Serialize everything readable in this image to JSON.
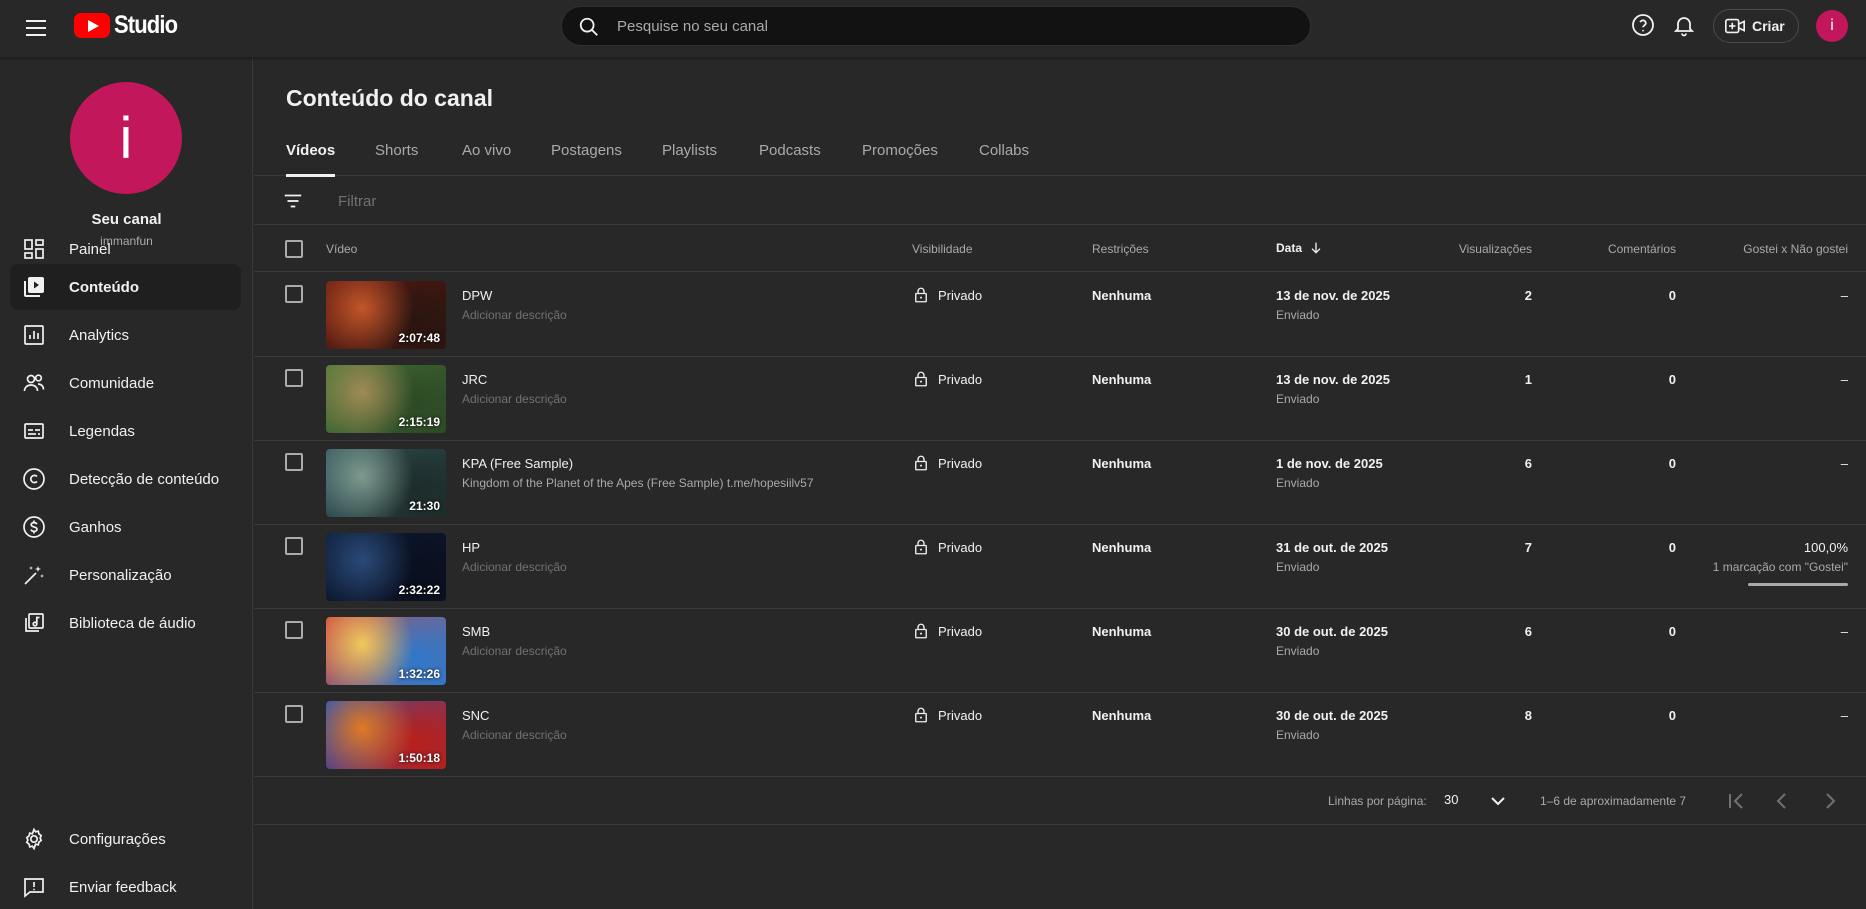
{
  "header": {
    "logo_text": "Studio",
    "search_placeholder": "Pesquise no seu canal",
    "create_label": "Criar",
    "avatar_letter": "i"
  },
  "sidebar": {
    "avatar_letter": "i",
    "channel_title": "Seu canal",
    "channel_handle": "immanfun",
    "items": [
      {
        "label": "Painel",
        "icon": "dashboard-icon"
      },
      {
        "label": "Conteúdo",
        "icon": "content-icon",
        "active": true
      },
      {
        "label": "Analytics",
        "icon": "analytics-icon"
      },
      {
        "label": "Comunidade",
        "icon": "community-icon"
      },
      {
        "label": "Legendas",
        "icon": "subtitles-icon"
      },
      {
        "label": "Detecção de conteúdo",
        "icon": "copyright-icon"
      },
      {
        "label": "Ganhos",
        "icon": "earn-icon"
      },
      {
        "label": "Personalização",
        "icon": "customization-icon"
      },
      {
        "label": "Biblioteca de áudio",
        "icon": "audio-library-icon"
      }
    ],
    "footer": [
      {
        "label": "Configurações",
        "icon": "settings-icon"
      },
      {
        "label": "Enviar feedback",
        "icon": "feedback-icon"
      }
    ]
  },
  "main": {
    "title": "Conteúdo do canal",
    "tabs": [
      "Vídeos",
      "Shorts",
      "Ao vivo",
      "Postagens",
      "Playlists",
      "Podcasts",
      "Promoções",
      "Collabs"
    ],
    "filter_placeholder": "Filtrar",
    "columns": {
      "video": "Vídeo",
      "visibility": "Visibilidade",
      "restrictions": "Restrições",
      "date": "Data",
      "views": "Visualizações",
      "comments": "Comentários",
      "likes": "Gostei x Não gostei"
    },
    "rows": [
      {
        "title": "DPW",
        "description": "Adicionar descrição",
        "duration": "2:07:48",
        "visibility": "Privado",
        "restrictions": "Nenhuma",
        "date": "13 de nov. de 2025",
        "date_status": "Enviado",
        "views": "2",
        "comments": "0",
        "likes": "–",
        "colors": [
          "#6b1d12",
          "#c2562a",
          "#2a1510"
        ]
      },
      {
        "title": "JRC",
        "description": "Adicionar descrição",
        "duration": "2:15:19",
        "visibility": "Privado",
        "restrictions": "Nenhuma",
        "date": "13 de nov. de 2025",
        "date_status": "Enviado",
        "views": "1",
        "comments": "0",
        "likes": "–",
        "colors": [
          "#4f7a3a",
          "#a08a55",
          "#2c4a26"
        ]
      },
      {
        "title": "KPA (Free Sample)",
        "description": "Kingdom of the Planet of the Apes (Free Sample) t.me/hopesiilv57",
        "duration": "21:30",
        "visibility": "Privado",
        "restrictions": "Nenhuma",
        "date": "1 de nov. de 2025",
        "date_status": "Enviado",
        "views": "6",
        "comments": "0",
        "likes": "–",
        "colors": [
          "#3a5e66",
          "#7e9a8e",
          "#1c2c2a"
        ]
      },
      {
        "title": "HP",
        "description": "Adicionar descrição",
        "duration": "2:32:22",
        "visibility": "Privado",
        "restrictions": "Nenhuma",
        "date": "31 de out. de 2025",
        "date_status": "Enviado",
        "views": "7",
        "comments": "0",
        "likes": "100,0%",
        "likes_sub": "1 marcação com \"Gostei\"",
        "likes_ratio": 1.0,
        "colors": [
          "#0d1e3a",
          "#2b4a78",
          "#0a0f1e"
        ]
      },
      {
        "title": "SMB",
        "description": "Adicionar descrição",
        "duration": "1:32:26",
        "visibility": "Privado",
        "restrictions": "Nenhuma",
        "date": "30 de out. de 2025",
        "date_status": "Enviado",
        "views": "6",
        "comments": "0",
        "likes": "–",
        "colors": [
          "#d8493c",
          "#f2c85a",
          "#2f78c9"
        ]
      },
      {
        "title": "SNC",
        "description": "Adicionar descrição",
        "duration": "1:50:18",
        "visibility": "Privado",
        "restrictions": "Nenhuma",
        "date": "30 de out. de 2025",
        "date_status": "Enviado",
        "views": "8",
        "comments": "0",
        "likes": "–",
        "colors": [
          "#2a58b8",
          "#e07a24",
          "#b8201c"
        ]
      }
    ],
    "pagination": {
      "rows_label": "Linhas por página:",
      "rows_value": "30",
      "range": "1–6 de aproximadamente 7"
    }
  }
}
